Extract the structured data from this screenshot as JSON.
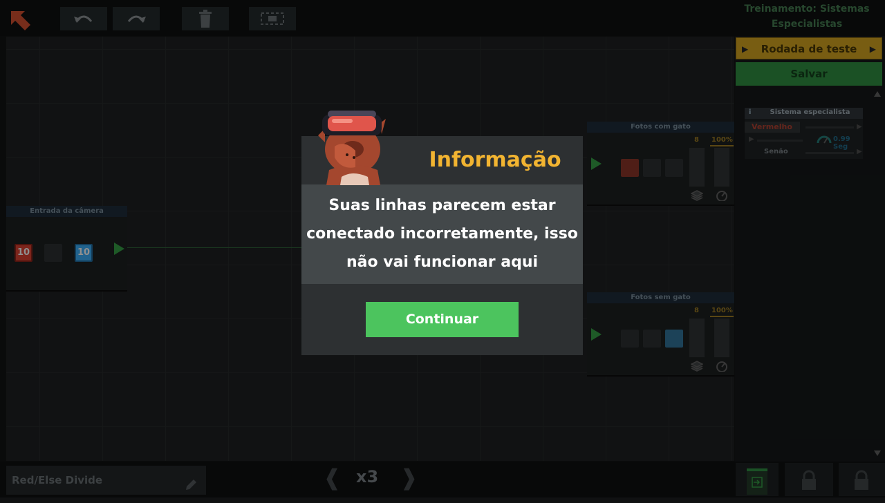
{
  "header": {
    "title": "Treinamento: Sistemas Especialistas"
  },
  "nodes": {
    "camera": {
      "title": "Entrada da câmera",
      "values": [
        "10",
        "10"
      ]
    },
    "with_cat": {
      "title": "Fotos com gato",
      "count": "8",
      "accuracy": "100%"
    },
    "without_cat": {
      "title": "Fotos sem gato",
      "count": "8",
      "accuracy": "100%"
    }
  },
  "panel": {
    "test_round": "Rodada de teste",
    "save": "Salvar",
    "expert": {
      "title": "Sistema especialista",
      "info": "i",
      "rule": "Vermelho",
      "speed": "0.99 Seg",
      "else": "Senão"
    }
  },
  "bottom": {
    "name": "Red/Else Divide",
    "speed": "x3",
    "prev": "❰",
    "next": "❱"
  },
  "dialog": {
    "title": "Informação",
    "message_lines": [
      "Suas linhas parecem estar",
      "conectado incorretamente, isso",
      "não vai funcionar aqui"
    ],
    "button": "Continuar"
  },
  "colors": {
    "accent": "#f2b431",
    "continue": "#4cc45e",
    "test_button": "#b8901c",
    "save_button": "#2a7d3a"
  }
}
